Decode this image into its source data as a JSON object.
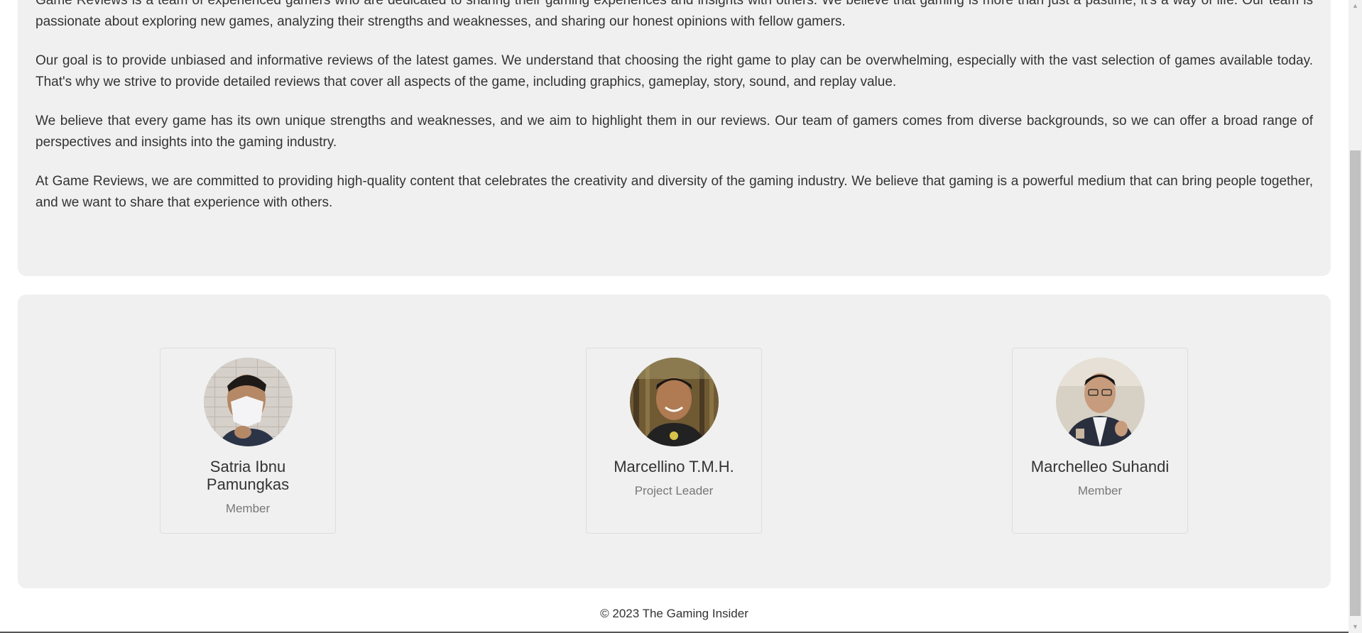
{
  "about": {
    "paragraphs": [
      "Game Reviews is a team of experienced gamers who are dedicated to sharing their gaming experiences and insights with others. We believe that gaming is more than just a pastime; it's a way of life. Our team is passionate about exploring new games, analyzing their strengths and weaknesses, and sharing our honest opinions with fellow gamers.",
      "Our goal is to provide unbiased and informative reviews of the latest games. We understand that choosing the right game to play can be overwhelming, especially with the vast selection of games available today. That's why we strive to provide detailed reviews that cover all aspects of the game, including graphics, gameplay, story, sound, and replay value.",
      "We believe that every game has its own unique strengths and weaknesses, and we aim to highlight them in our reviews. Our team of gamers comes from diverse backgrounds, so we can offer a broad range of perspectives and insights into the gaming industry.",
      "At Game Reviews, we are committed to providing high-quality content that celebrates the creativity and diversity of the gaming industry. We believe that gaming is a powerful medium that can bring people together, and we want to share that experience with others."
    ]
  },
  "team": {
    "members": [
      {
        "name": "Satria Ibnu Pamungkas",
        "role": "Member",
        "avatar_icon": "person-photo-icon"
      },
      {
        "name": "Marcellino T.M.H.",
        "role": "Project Leader",
        "avatar_icon": "person-photo-icon"
      },
      {
        "name": "Marchelleo Suhandi",
        "role": "Member",
        "avatar_icon": "person-photo-icon"
      }
    ]
  },
  "footer": {
    "copyright": "© 2023 The Gaming Insider"
  },
  "scrollbar": {
    "up_icon": "scroll-up-arrow-icon",
    "down_icon": "scroll-down-arrow-icon"
  },
  "colors": {
    "card_background": "#f0f0f0",
    "text": "#333333",
    "muted_text": "#777777"
  }
}
